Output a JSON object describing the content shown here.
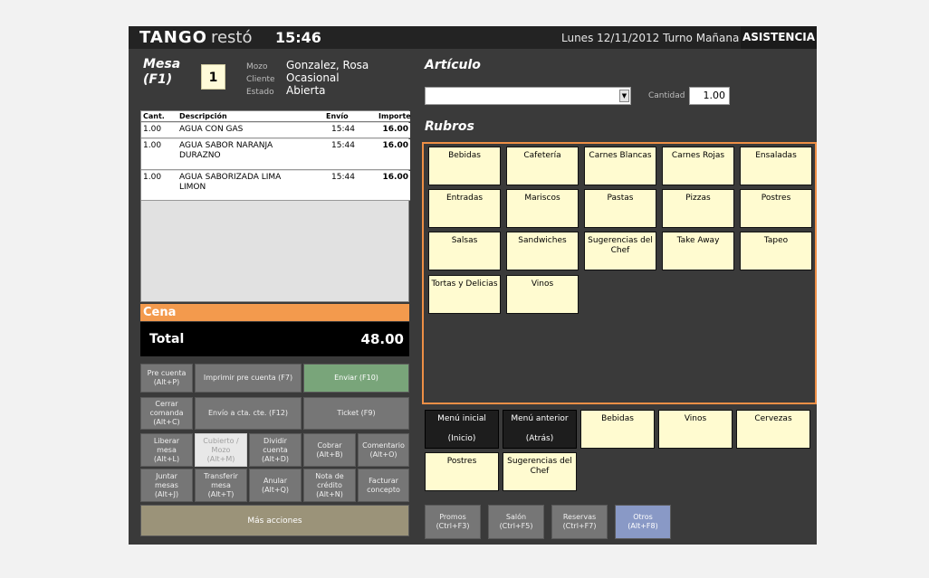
{
  "header": {
    "logo_main": "TANGO",
    "logo_sub": "restó",
    "clock": "15:46",
    "date_shift": "Lunes 12/11/2012 Turno Mañana",
    "asistencia": "ASISTENCIA"
  },
  "mesa": {
    "title_line1": "Mesa",
    "title_line2": "(F1)",
    "number": "1",
    "mozo_label": "Mozo",
    "mozo_value": "Gonzalez, Rosa",
    "cliente_label": "Cliente",
    "cliente_value": "Ocasional",
    "estado_label": "Estado",
    "estado_value": "Abierta"
  },
  "order": {
    "headers": {
      "cant": "Cant.",
      "desc": "Descripción",
      "envio": "Envío",
      "importe": "Importe"
    },
    "rows": [
      {
        "cant": "1.00",
        "desc1": "AGUA CON GAS",
        "desc2": "",
        "envio": "15:44",
        "importe": "16.00"
      },
      {
        "cant": "1.00",
        "desc1": "AGUA SABOR NARANJA",
        "desc2": "DURAZNO",
        "envio": "15:44",
        "importe": "16.00"
      },
      {
        "cant": "1.00",
        "desc1": "AGUA SABORIZADA LIMA",
        "desc2": "LIMON",
        "envio": "15:44",
        "importe": "16.00"
      }
    ],
    "cena": "Cena",
    "total_label": "Total",
    "total_value": "48.00"
  },
  "actions": {
    "pre_cuenta_1": "Pre cuenta",
    "pre_cuenta_2": "(Alt+P)",
    "imprimir": "Imprimir pre cuenta (F7)",
    "enviar": "Enviar (F10)",
    "cerrar_1": "Cerrar",
    "cerrar_2": "comanda",
    "cerrar_3": "(Alt+C)",
    "envio_cta": "Envío a cta. cte. (F12)",
    "ticket": "Ticket (F9)",
    "liberar_1": "Liberar",
    "liberar_2": "mesa",
    "liberar_3": "(Alt+L)",
    "cubierto_1": "Cubierto /",
    "cubierto_2": "Mozo",
    "cubierto_3": "(Alt+M)",
    "dividir_1": "Dividir",
    "dividir_2": "cuenta",
    "dividir_3": "(Alt+D)",
    "cobrar_1": "Cobrar",
    "cobrar_2": "(Alt+B)",
    "comentario_1": "Comentario",
    "comentario_2": "(Alt+O)",
    "juntar_1": "Juntar",
    "juntar_2": "mesas",
    "juntar_3": "(Alt+J)",
    "transferir_1": "Transferir",
    "transferir_2": "mesa",
    "transferir_3": "(Alt+T)",
    "anular_1": "Anular",
    "anular_2": "(Alt+Q)",
    "nota_1": "Nota de",
    "nota_2": "crédito",
    "nota_3": "(Alt+N)",
    "facturar_1": "Facturar",
    "facturar_2": "concepto",
    "mas": "Más acciones"
  },
  "articulo": {
    "title": "Artículo",
    "cantidad_label": "Cantidad",
    "cantidad_value": "1.00"
  },
  "rubros": {
    "title": "Rubros",
    "items": [
      "Bebidas",
      "Cafetería",
      "Carnes Blancas",
      "Carnes Rojas",
      "Ensaladas",
      "Entradas",
      "Mariscos",
      "Pastas",
      "Pizzas",
      "Postres",
      "Salsas",
      "Sandwiches",
      "Sugerencias del Chef",
      "Take Away",
      "Tapeo",
      "Tortas y Delicias",
      "Vinos"
    ]
  },
  "quick": {
    "menu_inicial_1": "Menú inicial",
    "menu_inicial_2": "(Inicio)",
    "menu_anterior_1": "Menú anterior",
    "menu_anterior_2": "(Atrás)",
    "items": [
      "Bebidas",
      "Vinos",
      "Cervezas",
      "Postres",
      "Sugerencias del Chef"
    ]
  },
  "bottom": {
    "promos_1": "Promos",
    "promos_2": "(Ctrl+F3)",
    "salon_1": "Salón",
    "salon_2": "(Ctrl+F5)",
    "reservas_1": "Reservas",
    "reservas_2": "(Ctrl+F7)",
    "otros_1": "Otros",
    "otros_2": "(Alt+F8)"
  },
  "colors": {
    "accent_orange": "#ee8f46",
    "tile_yellow": "#fffbd0",
    "send_green": "#79a57a",
    "otros_blue": "#8999c6"
  }
}
